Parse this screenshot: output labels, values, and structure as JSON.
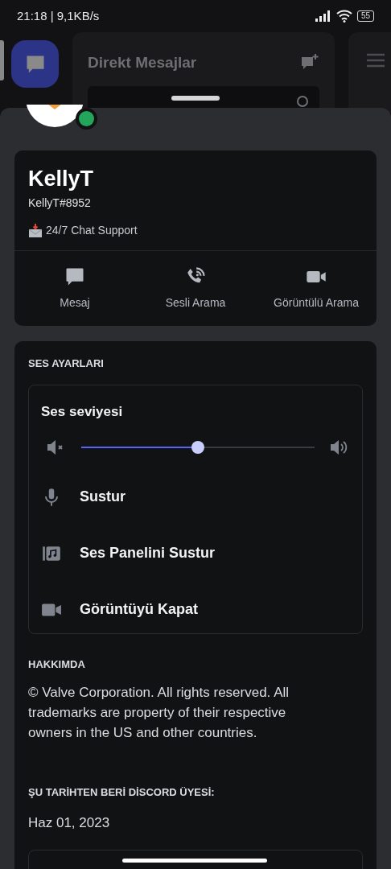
{
  "status_bar": {
    "time": "21:18 | 9,1KB/s",
    "battery": "55"
  },
  "background": {
    "title": "Direkt Mesajlar"
  },
  "profile": {
    "online": true,
    "name": "KellyT",
    "tag": "KellyT#8952",
    "custom_status": "24/7 Chat Support",
    "actions": [
      {
        "label": "Mesaj",
        "kind": "message"
      },
      {
        "label": "Sesli Arama",
        "kind": "voice"
      },
      {
        "label": "Görüntülü Arama",
        "kind": "video"
      }
    ]
  },
  "voice_settings": {
    "title": "SES AYARLARI",
    "volume": {
      "label": "Ses seviyesi",
      "level": 0.5
    },
    "options": [
      {
        "label": "Sustur",
        "kind": "mute"
      },
      {
        "label": "Ses Panelini Sustur",
        "kind": "soundboard"
      },
      {
        "label": "Görüntüyü Kapat",
        "kind": "video"
      }
    ]
  },
  "about": {
    "title": "HAKKIMDA",
    "text": "© Valve Corporation. All rights reserved. All trademarks are property of their respective owners in the US and other countries."
  },
  "member_since": {
    "title": "ŞU TARİHTEN BERİ DİSCORD ÜYESİ:",
    "date": "Haz 01, 2023"
  }
}
